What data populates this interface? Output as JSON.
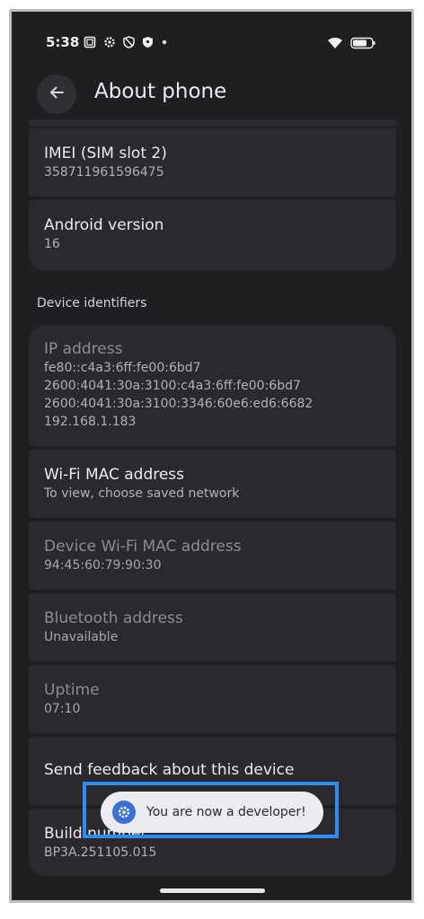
{
  "status_bar": {
    "time": "5:38",
    "left_icons": [
      "screenshot-icon",
      "settings-gear-icon",
      "vpn-shield-icon",
      "shield-icon",
      "dot-icon"
    ],
    "right_icons": [
      "wifi-icon",
      "battery-icon"
    ]
  },
  "header": {
    "title": "About phone",
    "back_icon": "arrow-back-icon"
  },
  "items_top": [
    {
      "title": "IMEI (SIM slot 2)",
      "value": "358711961596475"
    },
    {
      "title": "Android version",
      "value": "16"
    }
  ],
  "section_device_identifiers": "Device identifiers",
  "ip_address": {
    "title": "IP address",
    "lines": [
      "fe80::c4a3:6ff:fe00:6bd7",
      "2600:4041:30a:3100:c4a3:6ff:fe00:6bd7",
      "2600:4041:30a:3100:3346:60e6:ed6:6682",
      "192.168.1.183"
    ]
  },
  "identifiers": [
    {
      "title": "Wi-Fi MAC address",
      "value": "To view, choose saved network"
    },
    {
      "title": "Device Wi-Fi MAC address",
      "value": "94:45:60:79:90:30"
    },
    {
      "title": "Bluetooth address",
      "value": "Unavailable"
    },
    {
      "title": "Uptime",
      "value": "07:10"
    }
  ],
  "feedback": {
    "title": "Send feedback about this device"
  },
  "build": {
    "title": "Build number",
    "value": "BP3A.251105.015"
  },
  "toast": {
    "text": "You are now a developer!",
    "icon": "settings-gear-icon"
  },
  "colors": {
    "background": "#1f1f22",
    "card": "#2a2a2e",
    "toast_bg": "#ececf0",
    "toast_icon": "#3b6fd8",
    "highlight": "#2f8cf0"
  }
}
